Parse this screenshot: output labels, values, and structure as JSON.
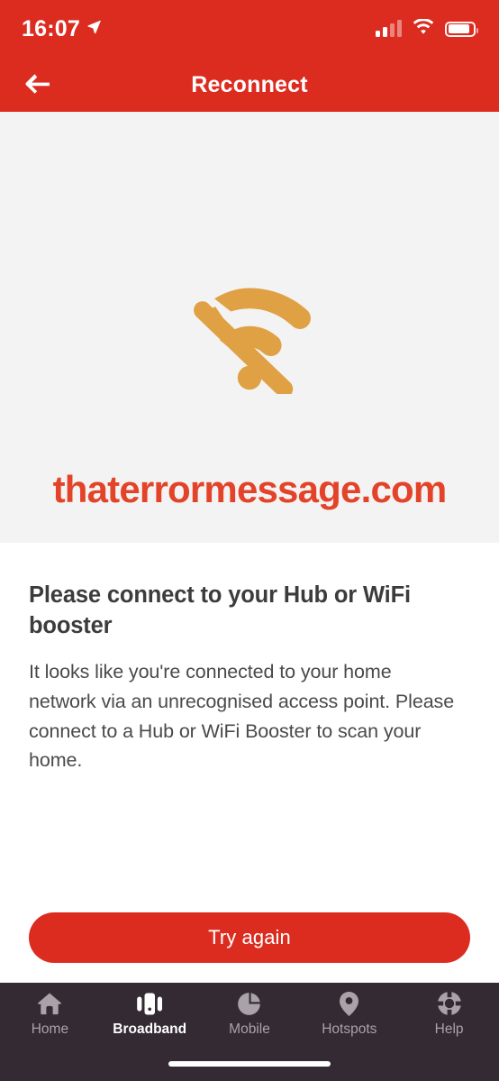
{
  "status_bar": {
    "time": "16:07",
    "location_icon": "location-arrow-icon",
    "signal_icon": "cellular-signal-icon",
    "signal_bars_filled": 2,
    "signal_bars_total": 4,
    "wifi_icon": "wifi-icon",
    "battery_icon": "battery-icon",
    "battery_level_percent": 88
  },
  "header": {
    "back_icon": "back-arrow-icon",
    "title": "Reconnect",
    "background_color": "#DC2C20"
  },
  "hero": {
    "illustration_icon": "wifi-off-icon",
    "illustration_color": "#E0A044",
    "background_color": "#F3F3F3",
    "watermark": "thaterrormessage.com",
    "watermark_color": "#E34328"
  },
  "main": {
    "title": "Please connect to your Hub or WiFi booster",
    "body": "It looks like you're connected to your home network via an unrecognised access point. Please connect to a Hub or WiFi Booster to scan your home.",
    "primary_action": "Try again",
    "primary_action_color": "#DC2C20"
  },
  "tabbar": {
    "background_color": "#332A33",
    "active_index": 1,
    "items": [
      {
        "label": "Home",
        "icon": "house-icon"
      },
      {
        "label": "Broadband",
        "icon": "router-hub-icon"
      },
      {
        "label": "Mobile",
        "icon": "pie-chart-icon"
      },
      {
        "label": "Hotspots",
        "icon": "map-pin-icon"
      },
      {
        "label": "Help",
        "icon": "lifebuoy-icon"
      }
    ]
  }
}
